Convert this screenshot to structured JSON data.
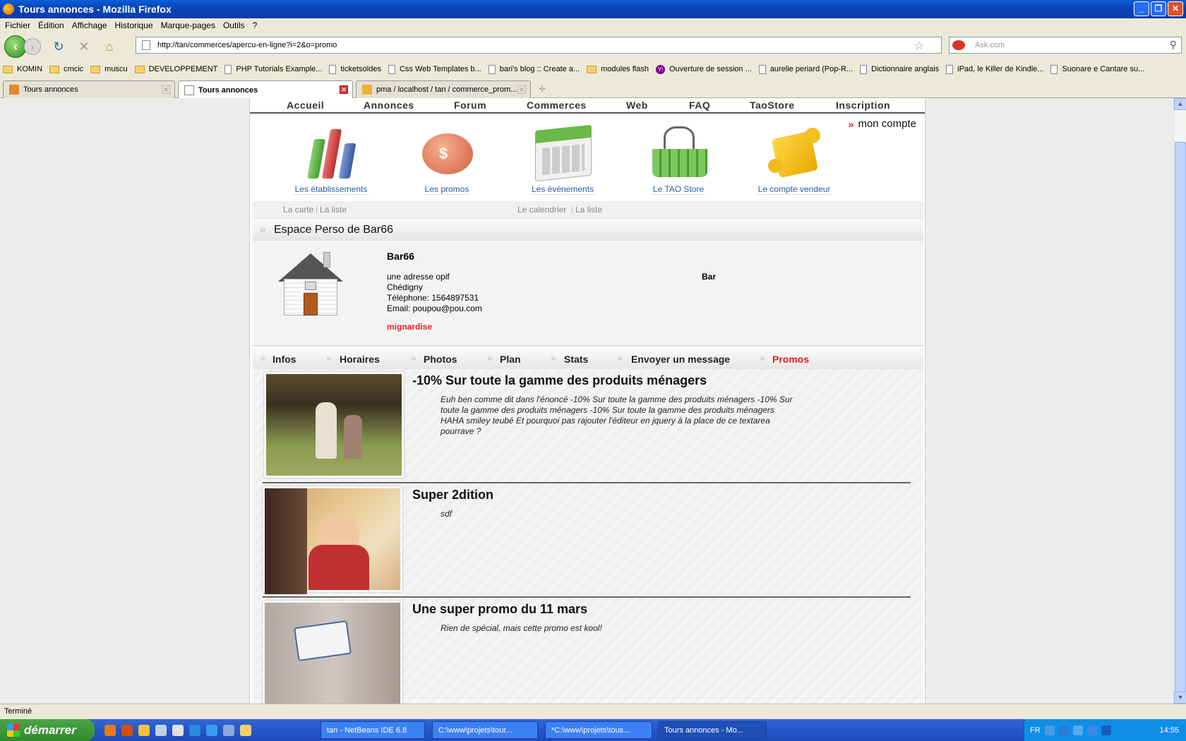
{
  "window": {
    "title": "Tours annonces - Mozilla Firefox"
  },
  "menu": [
    "Fichier",
    "Édition",
    "Affichage",
    "Historique",
    "Marque-pages",
    "Outils",
    "?"
  ],
  "address": {
    "url": "http://tan/commerces/apercu-en-ligne?i=2&o=promo"
  },
  "search": {
    "placeholder": "Ask.com"
  },
  "bookmarks": [
    {
      "label": "KOMIN",
      "icon": "folder"
    },
    {
      "label": "cmcic",
      "icon": "folder"
    },
    {
      "label": "muscu",
      "icon": "folder"
    },
    {
      "label": "DEVELOPPEMENT",
      "icon": "folder"
    },
    {
      "label": "PHP Tutorials Example...",
      "icon": "doc"
    },
    {
      "label": "ticketsoldes",
      "icon": "doc"
    },
    {
      "label": "Css Web Templates b...",
      "icon": "doc"
    },
    {
      "label": "bari's blog :: Create a...",
      "icon": "doc"
    },
    {
      "label": "modules flash",
      "icon": "folder"
    },
    {
      "label": "Ouverture de session ...",
      "icon": "yahoo"
    },
    {
      "label": "aurelie periard (Pop-R...",
      "icon": "doc"
    },
    {
      "label": "Dictionnaire anglais",
      "icon": "doc"
    },
    {
      "label": "iPad, le Killer de Kindle...",
      "icon": "doc"
    },
    {
      "label": "Suonare e Cantare su...",
      "icon": "doc"
    }
  ],
  "tabs": [
    {
      "label": "Tours annonces",
      "active": false
    },
    {
      "label": "Tours annonces",
      "active": true
    },
    {
      "label": "pma / localhost / tan / commerce_prom...",
      "active": false
    }
  ],
  "site": {
    "nav": [
      "Accueil",
      "Annonces",
      "Forum",
      "Commerces",
      "Web",
      "FAQ",
      "TaoStore",
      "Inscription"
    ],
    "account": "mon compte",
    "icons": [
      {
        "label": "Les établissements",
        "icon": "bar-chart-icon"
      },
      {
        "label": "Les promos",
        "icon": "piggy-bank-icon"
      },
      {
        "label": "Les événements",
        "icon": "calendar-icon"
      },
      {
        "label": "Le TAO Store",
        "icon": "basket-icon"
      },
      {
        "label": "Le compte vendeur",
        "icon": "puzzle-icon"
      }
    ],
    "sublinks": {
      "carte": "La carte",
      "liste1": "La liste",
      "calendrier": "Le calendrier",
      "liste2": "La liste"
    },
    "section_title": "Espace Perso de Bar66",
    "profile": {
      "name": "Bar66",
      "address": "une adresse opif",
      "city": "Chédigny",
      "phone": "Téléphone: 1564897531",
      "email": "Email: poupou@pou.com",
      "type": "Bar",
      "tag": "mignardise"
    },
    "tabs": [
      "Infos",
      "Horaires",
      "Photos",
      "Plan",
      "Stats",
      "Envoyer un message",
      "Promos"
    ],
    "active_tab": "Promos",
    "promos": [
      {
        "title": "-10% Sur toute la gamme des produits ménagers",
        "desc": "Euh ben comme dit dans l'énoncé -10% Sur toute la gamme des produits ménagers -10% Sur toute la gamme des produits ménagers -10% Sur toute la gamme des produits ménagers HAHA smiley teubé Et pourquoi pas rajouter l'éditeur en jquery à la place de ce textarea pourrave ?"
      },
      {
        "title": "Super 2dition",
        "desc": "sdf"
      },
      {
        "title": "Une super promo du 11 mars",
        "desc": "Rien de spécial, mais cette promo est kool!"
      }
    ]
  },
  "status": "Terminé",
  "taskbar": {
    "start": "démarrer",
    "buttons": [
      "tan - NetBeans IDE 6.8",
      "C:\\www\\projets\\tour...",
      "*C:\\www\\projets\\tous...",
      "Tours annonces - Mo..."
    ],
    "lang": "FR",
    "clock": "14:55"
  }
}
